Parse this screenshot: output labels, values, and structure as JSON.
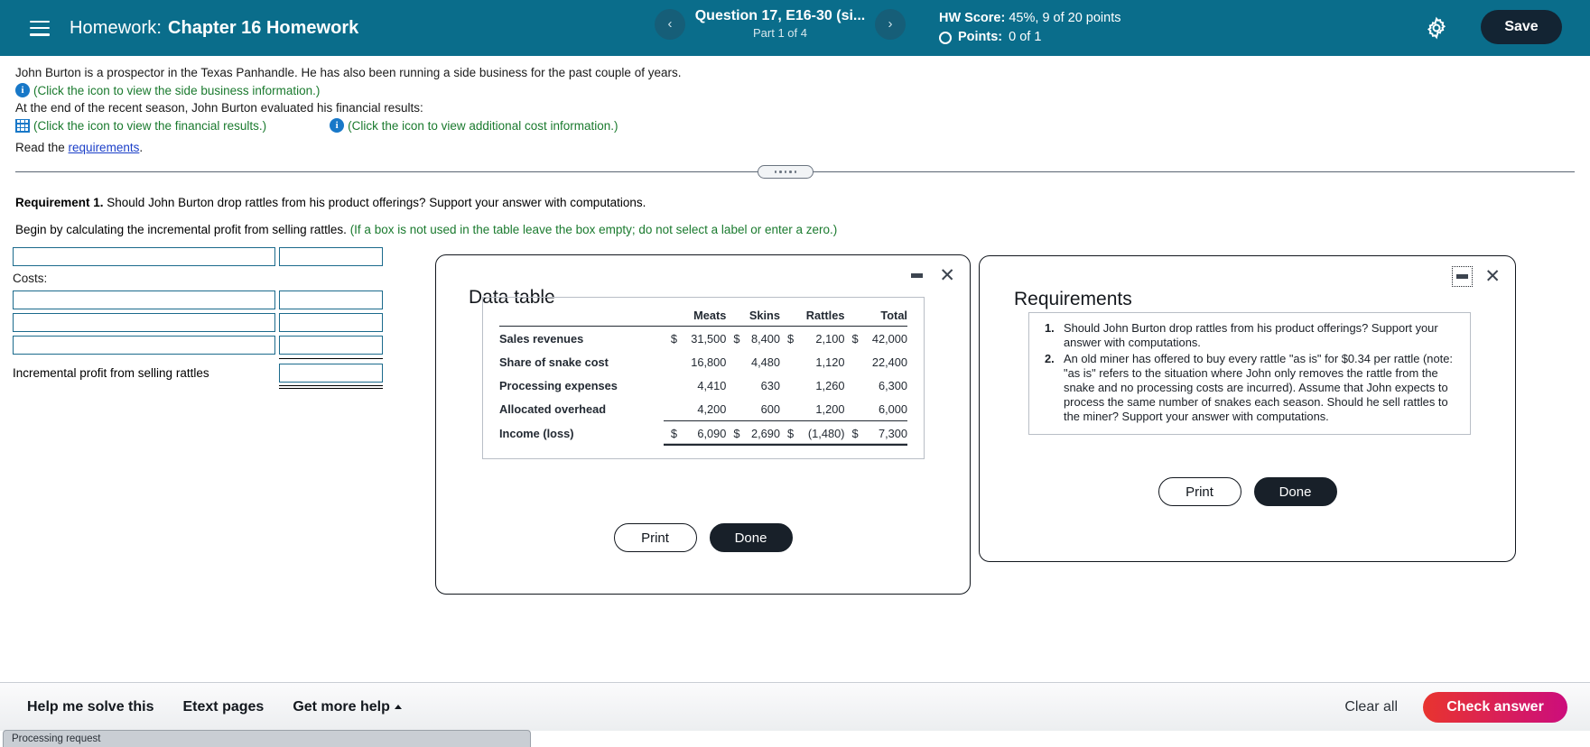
{
  "header": {
    "menu_icon": "hamburger-icon",
    "label": "Homework:",
    "title": "Chapter 16 Homework",
    "prev_icon": "‹",
    "next_icon": "›",
    "question_title": "Question 17, E16-30 (si...",
    "question_part": "Part 1 of 4",
    "hw_score_label": "HW Score:",
    "hw_score_value": "45%, 9 of 20 points",
    "points_label": "Points:",
    "points_value": "0 of 1",
    "settings_icon": "gear-icon",
    "save_label": "Save",
    "bg_color": "#0a6d8b",
    "save_bg_color": "#132433"
  },
  "statement": {
    "line1": "John Burton is a prospector in the Texas Panhandle. He has also been running a side business for the past couple of years.",
    "side_business_link": "(Click the icon to view the side business information.)",
    "line2": "At the end of the recent season, John Burton evaluated his financial results:",
    "financial_results_link": "(Click the icon to view the financial results.)",
    "additional_cost_link": "(Click the icon to view additional cost information.)",
    "read_prefix": "Read the ",
    "read_link": "requirements",
    "read_suffix": ".",
    "link_color": "#1a7a2e",
    "icon_color": "#1878c8"
  },
  "requirement": {
    "label": "Requirement 1.",
    "text": " Should John Burton drop rattles from his product offerings? Support your answer with computations.",
    "begin_text": "Begin by calculating the incremental profit from selling rattles. ",
    "begin_hint": "(If a box is not used in the table leave the box empty; do not select a label or enter a zero.)",
    "costs_label": "Costs:",
    "total_label": "Incremental profit from selling rattles",
    "input_border_color": "#1b6a8c",
    "rows": [
      {
        "label_value": "",
        "value_value": ""
      },
      {
        "label_value": "",
        "value_value": ""
      },
      {
        "label_value": "",
        "value_value": ""
      },
      {
        "label_value": "",
        "value_value": ""
      }
    ]
  },
  "data_table_dialog": {
    "title": "Data table",
    "minimize_icon": "minimize-icon",
    "close_icon": "close-icon",
    "print_label": "Print",
    "done_label": "Done",
    "columns": [
      "",
      "Meats",
      "Skins",
      "Rattles",
      "Total"
    ],
    "rows": [
      {
        "label": "Sales revenues",
        "currency": "$",
        "meats": "31,500",
        "skins": "8,400",
        "rattles": "2,100",
        "total": "42,000",
        "show_currency": true
      },
      {
        "label": "Share of snake cost",
        "currency": "",
        "meats": "16,800",
        "skins": "4,480",
        "rattles": "1,120",
        "total": "22,400",
        "show_currency": false
      },
      {
        "label": "Processing expenses",
        "currency": "",
        "meats": "4,410",
        "skins": "630",
        "rattles": "1,260",
        "total": "6,300",
        "show_currency": false
      },
      {
        "label": "Allocated overhead",
        "currency": "",
        "meats": "4,200",
        "skins": "600",
        "rattles": "1,200",
        "total": "6,000",
        "show_currency": false
      },
      {
        "label": "Income (loss)",
        "currency": "$",
        "meats": "6,090",
        "skins": "2,690",
        "rattles": "(1,480)",
        "total": "7,300",
        "show_currency": true
      }
    ]
  },
  "requirements_dialog": {
    "title": "Requirements",
    "minimize_icon": "minimize-icon",
    "close_icon": "close-icon",
    "print_label": "Print",
    "done_label": "Done",
    "items": [
      {
        "num": "1.",
        "text": "Should John Burton drop rattles from his product offerings? Support your answer with computations."
      },
      {
        "num": "2.",
        "text": "An old miner has offered to buy every rattle \"as is\" for $0.34 per rattle (note: \"as is\" refers to the situation where John only removes the rattle from the snake and no processing costs are incurred). Assume that John expects to process the same number of snakes each season. Should he sell rattles to the miner? Support your answer with computations."
      }
    ]
  },
  "footer": {
    "help_me_solve": "Help me solve this",
    "etext_pages": "Etext pages",
    "get_more_help": "Get more help",
    "clear_all": "Clear all",
    "check_answer": "Check answer",
    "check_answer_gradient_start": "#e8342f",
    "check_answer_gradient_end": "#cc0d7c",
    "status_text": "Processing request"
  }
}
